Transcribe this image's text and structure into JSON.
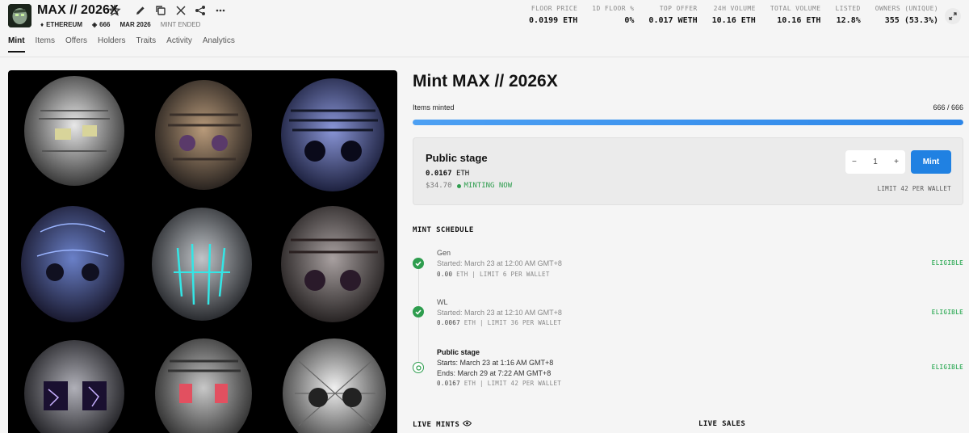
{
  "collection": {
    "title": "MAX // 2026X",
    "chain": "ETHEREUM",
    "supply": "666",
    "date": "MAR 2026",
    "status": "MINT ENDED"
  },
  "stats": [
    {
      "label": "FLOOR PRICE",
      "value": "0.0199 ETH"
    },
    {
      "label": "1D FLOOR %",
      "value": "0%"
    },
    {
      "label": "TOP OFFER",
      "value": "0.017 WETH"
    },
    {
      "label": "24H VOLUME",
      "value": "10.16 ETH"
    },
    {
      "label": "TOTAL VOLUME",
      "value": "10.16 ETH"
    },
    {
      "label": "LISTED",
      "value": "12.8%"
    },
    {
      "label": "OWNERS (UNIQUE)",
      "value": "355 (53.3%)"
    }
  ],
  "tabs": [
    "Mint",
    "Items",
    "Offers",
    "Holders",
    "Traits",
    "Activity",
    "Analytics"
  ],
  "mint": {
    "title": "Mint MAX // 2026X",
    "items_label": "Items minted",
    "items_value": "666 / 666",
    "progress": 1.0,
    "stage_name": "Public stage",
    "price_amount": "0.0167",
    "price_unit": "ETH",
    "usd": "$34.70",
    "status": "MINTING NOW",
    "quantity": "1",
    "minus": "−",
    "plus": "+",
    "button": "Mint",
    "limit": "LIMIT 42 PER WALLET"
  },
  "schedule": {
    "title": "MINT SCHEDULE",
    "phases": [
      {
        "name": "Gen",
        "line1": "Started: March 23 at 12:00 AM GMT+8",
        "line2": "",
        "price": "0.00",
        "meta": "ETH | LIMIT 6 PER WALLET",
        "eligibility": "ELIGIBLE"
      },
      {
        "name": "WL",
        "line1": "Started: March 23 at 12:10 AM GMT+8",
        "line2": "",
        "price": "0.0067",
        "meta": "ETH | LIMIT 36 PER WALLET",
        "eligibility": "ELIGIBLE"
      },
      {
        "name": "Public stage",
        "line1": "Starts: March 23 at 1:16 AM GMT+8",
        "line2": "Ends: March 29 at 7:22 AM GMT+8",
        "price": "0.0167",
        "meta": "ETH | LIMIT 42 PER WALLET",
        "eligibility": "ELIGIBLE"
      }
    ]
  },
  "footer": {
    "live_mints": "LIVE MINTS",
    "live_sales": "LIVE SALES"
  },
  "colors": {
    "accent": "#2081e2",
    "success": "#2e9d4e",
    "artwork_bg": "#000000"
  },
  "icons": [
    "diamond-icon",
    "layers-icon",
    "star-icon",
    "edit-icon",
    "copy-icon",
    "x-icon",
    "share-icon",
    "more-icon",
    "expand-icon",
    "check-icon",
    "live-icon",
    "eye-icon"
  ]
}
